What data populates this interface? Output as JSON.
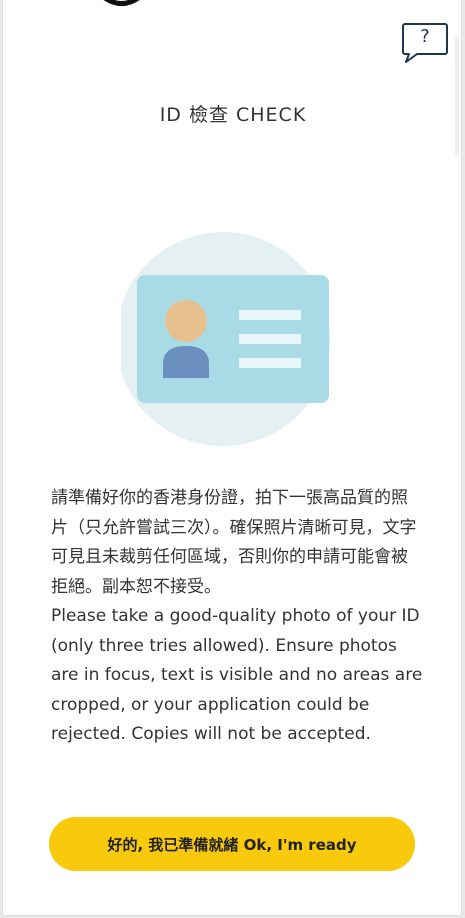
{
  "header": {
    "title": "ID 檢查 CHECK",
    "help_icon_glyph": "?"
  },
  "illustration": {
    "icon": "id-card-icon",
    "colors": {
      "circle_bg": "#e4f0f2",
      "card": "#a9dbe7",
      "avatar_head": "#e6c08d",
      "avatar_body": "#6a8fbf",
      "card_lines": "#e9f6f9"
    }
  },
  "instructions": {
    "chinese": "請準備好你的香港身份證，拍下一張高品質的照片（只允許嘗試三次）。確保照片清晰可見，文字可見且未裁剪任何區域，否則你的申請可能會被拒絕。副本恕不接受。",
    "english": "Please take a good-quality photo of your ID (only three tries allowed). Ensure photos are in focus, text is visible and no areas are cropped, or your application could be rejected. Copies will not be accepted."
  },
  "actions": {
    "ready_label": "好的, 我已準備就緒 Ok, I'm ready"
  },
  "colors": {
    "accent": "#f8ca0b",
    "help_icon": "#1f3550",
    "text": "#333333"
  }
}
